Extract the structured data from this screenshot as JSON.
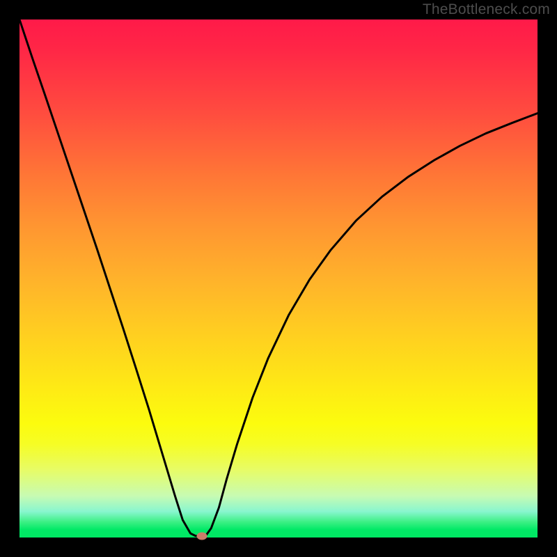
{
  "watermark": "TheBottleneck.com",
  "chart_data": {
    "type": "line",
    "title": "",
    "xlabel": "",
    "ylabel": "",
    "xlim": [
      0,
      100
    ],
    "ylim": [
      0,
      100
    ],
    "grid": false,
    "legend": false,
    "gradient_stops": [
      {
        "pos": 0,
        "color": "#ff1a49"
      },
      {
        "pos": 18,
        "color": "#ff4c3f"
      },
      {
        "pos": 40,
        "color": "#ff9631"
      },
      {
        "pos": 60,
        "color": "#ffcd21"
      },
      {
        "pos": 78,
        "color": "#fcfc0e"
      },
      {
        "pos": 92,
        "color": "#c7fbb3"
      },
      {
        "pos": 97,
        "color": "#3cf084"
      },
      {
        "pos": 100,
        "color": "#00e763"
      }
    ],
    "series": [
      {
        "name": "bottleneck-curve",
        "x": [
          0.0,
          2.5,
          5.0,
          7.5,
          10.0,
          12.5,
          15.0,
          17.5,
          20.0,
          22.5,
          25.0,
          27.5,
          30.0,
          31.5,
          33.0,
          34.0,
          35.0,
          36.0,
          37.0,
          38.5,
          40.0,
          42.0,
          45.0,
          48.0,
          52.0,
          56.0,
          60.0,
          65.0,
          70.0,
          75.0,
          80.0,
          85.0,
          90.0,
          95.0,
          100.0
        ],
        "y": [
          100.0,
          92.5,
          85.2,
          77.8,
          70.4,
          63.0,
          55.6,
          48.0,
          40.4,
          32.6,
          24.7,
          16.4,
          8.1,
          3.4,
          0.8,
          0.3,
          0.3,
          0.4,
          1.8,
          5.8,
          11.3,
          18.0,
          27.0,
          34.6,
          43.0,
          49.8,
          55.4,
          61.2,
          65.8,
          69.6,
          72.8,
          75.6,
          78.0,
          80.0,
          81.9
        ]
      }
    ],
    "marker": {
      "x": 35.2,
      "y": 0.3,
      "color": "#cb7e6a"
    },
    "notes": "Values are estimated from pixel positions; axes have no visible tick labels so x/y are normalized 0–100."
  }
}
